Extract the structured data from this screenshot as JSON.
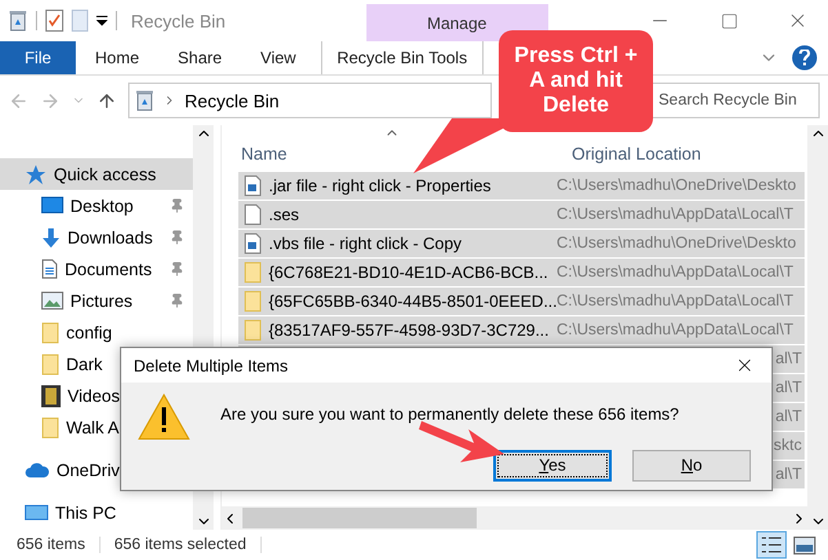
{
  "window": {
    "title": "Recycle Bin",
    "context_tab": "Manage"
  },
  "ribbon_tabs": [
    {
      "label": "File",
      "kind": "file",
      "selected": false
    },
    {
      "label": "Home",
      "kind": "plain",
      "selected": false
    },
    {
      "label": "Share",
      "kind": "plain",
      "selected": false
    },
    {
      "label": "View",
      "kind": "plain",
      "selected": false
    },
    {
      "label": "Recycle Bin Tools",
      "kind": "context",
      "selected": true
    }
  ],
  "address": {
    "path": "Recycle Bin"
  },
  "search": {
    "placeholder": "Search Recycle Bin"
  },
  "sidebar": {
    "items": [
      {
        "label": "Quick access",
        "kind": "star",
        "selected": true,
        "pinned": false
      },
      {
        "label": "Desktop",
        "kind": "desktop",
        "selected": false,
        "pinned": true
      },
      {
        "label": "Downloads",
        "kind": "download",
        "selected": false,
        "pinned": true
      },
      {
        "label": "Documents",
        "kind": "document",
        "selected": false,
        "pinned": true
      },
      {
        "label": "Pictures",
        "kind": "pictures",
        "selected": false,
        "pinned": true
      },
      {
        "label": "config",
        "kind": "folder",
        "selected": false,
        "pinned": false
      },
      {
        "label": "Dark",
        "kind": "folder",
        "selected": false,
        "pinned": false
      },
      {
        "label": "Videos",
        "kind": "video",
        "selected": false,
        "pinned": false
      },
      {
        "label": "Walk A",
        "kind": "folder",
        "selected": false,
        "pinned": false
      },
      {
        "label": "OneDriv",
        "kind": "cloud",
        "selected": false,
        "pinned": false
      },
      {
        "label": "This PC",
        "kind": "pc",
        "selected": false,
        "pinned": false
      }
    ]
  },
  "columns": [
    "Name",
    "Original Location"
  ],
  "rows": [
    {
      "name": ".jar file - right click - Properties",
      "kind": "image",
      "location": "C:\\Users\\madhu\\OneDrive\\Deskto",
      "selected": true
    },
    {
      "name": ".ses",
      "kind": "file",
      "location": "C:\\Users\\madhu\\AppData\\Local\\T",
      "selected": true
    },
    {
      "name": ".vbs file - right click - Copy",
      "kind": "image",
      "location": "C:\\Users\\madhu\\OneDrive\\Deskto",
      "selected": true
    },
    {
      "name": "{6C768E21-BD10-4E1D-ACB6-BCB...",
      "kind": "folder",
      "location": "C:\\Users\\madhu\\AppData\\Local\\T",
      "selected": true
    },
    {
      "name": "{65FC65BB-6340-44B5-8501-0EEED...",
      "kind": "folder",
      "location": "C:\\Users\\madhu\\AppData\\Local\\T",
      "selected": true
    },
    {
      "name": "{83517AF9-557F-4598-93D7-3C729...",
      "kind": "folder",
      "location": "C:\\Users\\madhu\\AppData\\Local\\T",
      "selected": true
    },
    {
      "kind": "tail",
      "location": "al\\T",
      "selected": true
    },
    {
      "kind": "tail",
      "location": "al\\T",
      "selected": true
    },
    {
      "kind": "tail",
      "location": "al\\T",
      "selected": true
    },
    {
      "kind": "tail",
      "location": "sktc",
      "selected": true
    },
    {
      "kind": "tail",
      "location": "al\\T",
      "selected": true
    }
  ],
  "status_bar": {
    "count": "656 items",
    "selected_count": "656 items selected",
    "views": [
      {
        "kind": "details",
        "selected": true
      },
      {
        "kind": "tiles",
        "selected": false
      }
    ]
  },
  "callout": {
    "text": "Press Ctrl + A and hit Delete"
  },
  "dialog": {
    "title": "Delete Multiple Items",
    "message": "Are you sure you want to permanently delete these 656 items?",
    "buttons": [
      {
        "label": "Yes",
        "focused": true
      },
      {
        "label": "No",
        "focused": false
      }
    ]
  }
}
